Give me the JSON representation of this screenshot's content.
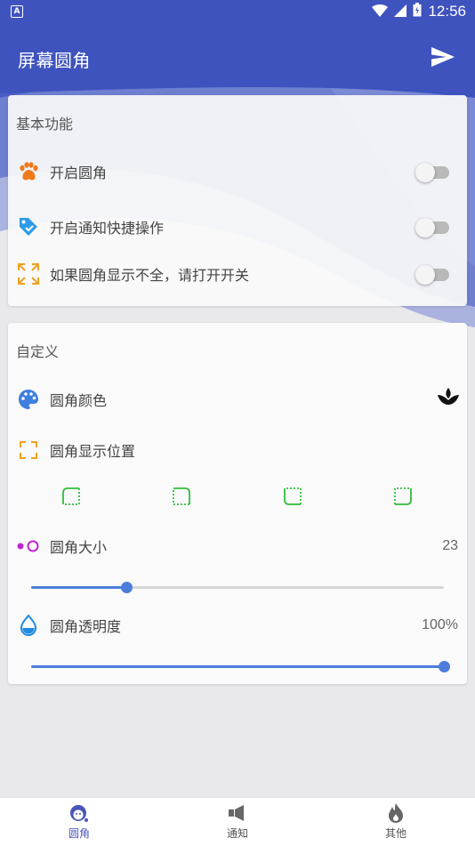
{
  "status_bar": {
    "time": "12:56",
    "app_icon_letter": "A"
  },
  "app_bar": {
    "title": "屏幕圆角",
    "send_icon": "send-icon"
  },
  "theme": {
    "primary": "#4355c0",
    "accent": "#4c7ddb",
    "green": "#2fbf3a",
    "orange": "#f08a24",
    "purple": "#c026d3"
  },
  "basic": {
    "title": "基本功能",
    "items": [
      {
        "label": "开启圆角",
        "icon": "paw-icon",
        "enabled": false
      },
      {
        "label": "开启通知快捷操作",
        "icon": "tag-icon",
        "enabled": false
      },
      {
        "label": "如果圆角显示不全，请打开开关",
        "icon": "expand-icon",
        "enabled": false
      }
    ]
  },
  "custom": {
    "title": "自定义",
    "color_label": "圆角颜色",
    "position_label": "圆角显示位置",
    "positions": [
      "top-left",
      "top-right",
      "bottom-left",
      "bottom-right"
    ],
    "size_label": "圆角大小",
    "size_value": "23",
    "size_fraction": 0.23,
    "opacity_label": "圆角透明度",
    "opacity_value": "100%",
    "opacity_fraction": 1.0
  },
  "bottom_nav": {
    "items": [
      {
        "label": "圆角",
        "icon": "corner-face-icon",
        "active": true
      },
      {
        "label": "通知",
        "icon": "speaker-icon",
        "active": false
      },
      {
        "label": "其他",
        "icon": "flame-icon",
        "active": false
      }
    ]
  }
}
